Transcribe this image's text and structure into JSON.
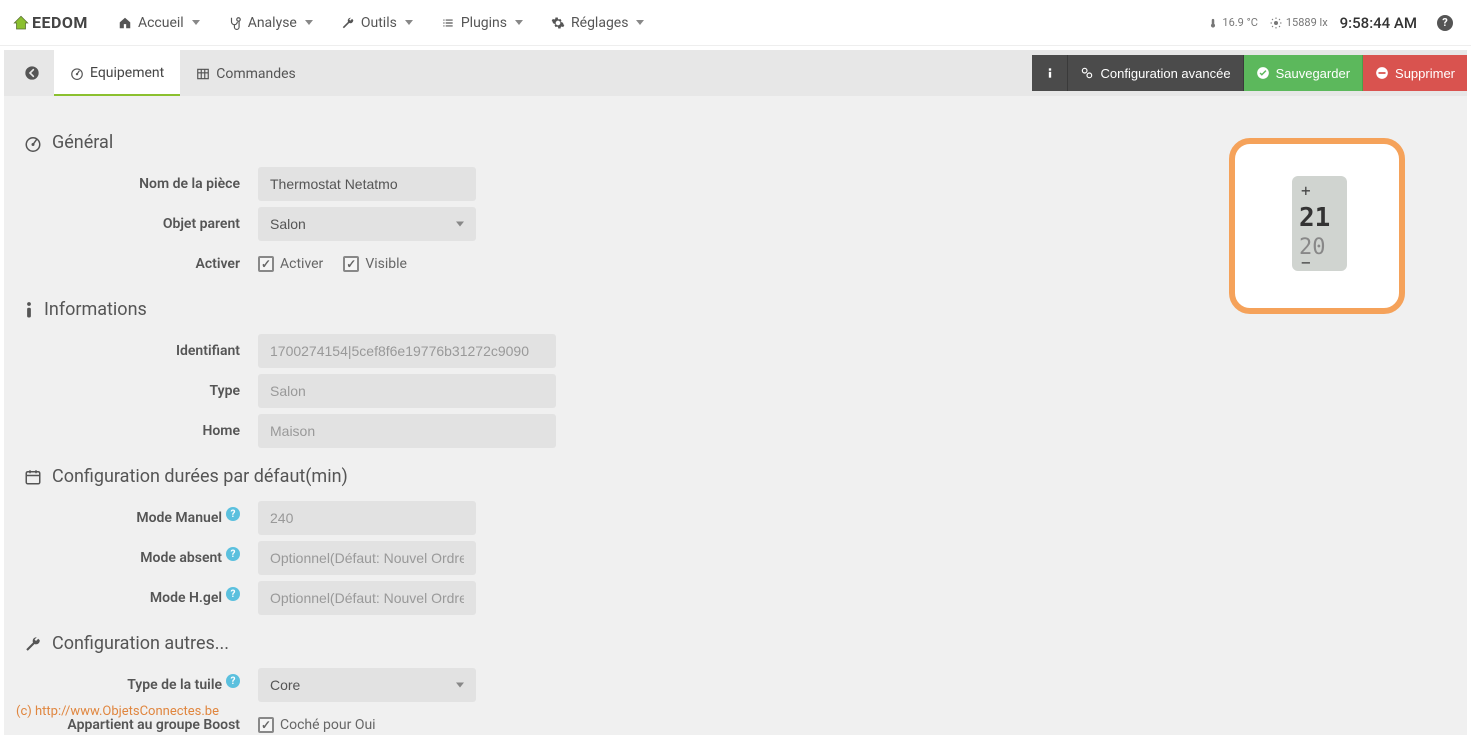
{
  "navbar": {
    "logo": "EEDOM",
    "items": [
      {
        "icon": "home",
        "label": "Accueil"
      },
      {
        "icon": "stethoscope",
        "label": "Analyse"
      },
      {
        "icon": "wrench",
        "label": "Outils"
      },
      {
        "icon": "list",
        "label": "Plugins"
      },
      {
        "icon": "gear",
        "label": "Réglages"
      }
    ],
    "sensor_temp": "16.9 °C",
    "sensor_lux": "15889 lx",
    "time": "9:58:44 AM"
  },
  "action_bar": {
    "tabs": [
      {
        "icon": "dashboard",
        "label": "Equipement",
        "active": true
      },
      {
        "icon": "table",
        "label": "Commandes",
        "active": false
      }
    ],
    "config_advanced": "Configuration avancée",
    "save": "Sauvegarder",
    "delete": "Supprimer"
  },
  "sections": {
    "general": {
      "title": "Général",
      "room_name_label": "Nom de la pièce",
      "room_name_value": "Thermostat Netatmo",
      "parent_label": "Objet parent",
      "parent_value": "Salon",
      "activate_label": "Activer",
      "cb_activate": "Activer",
      "cb_visible": "Visible"
    },
    "information": {
      "title": "Informations",
      "id_label": "Identifiant",
      "id_placeholder": "1700274154|5cef8f6e19776b31272c9090",
      "type_label": "Type",
      "type_placeholder": "Salon",
      "home_label": "Home",
      "home_placeholder": "Maison"
    },
    "durations": {
      "title": "Configuration durées par défaut(min)",
      "manual_label": "Mode Manuel",
      "manual_placeholder": "240",
      "away_label": "Mode absent",
      "away_placeholder": "Optionnel(Défaut: Nouvel Ordre)",
      "frost_label": "Mode H.gel",
      "frost_placeholder": "Optionnel(Défaut: Nouvel Ordre)"
    },
    "other": {
      "title": "Configuration autres...",
      "tile_label": "Type de la tuile",
      "tile_value": "Core",
      "boost_label": "Appartient au groupe Boost",
      "boost_cb": "Coché pour Oui"
    }
  },
  "watermark": "(c) http://www.ObjetsConnectes.be"
}
